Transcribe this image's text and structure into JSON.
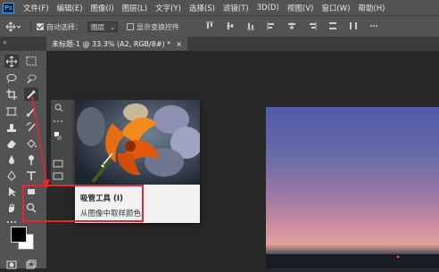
{
  "app": {
    "logo": "Ps"
  },
  "menu": [
    "文件(F)",
    "编辑(E)",
    "图像(I)",
    "图层(L)",
    "文字(Y)",
    "选择(S)",
    "滤镜(T)",
    "3D(D)",
    "视图(V)",
    "窗口(W)",
    "帮助(H)"
  ],
  "options": {
    "auto_select_label": "自动选择：",
    "auto_select_value": "图层",
    "show_transform_label": "显示变换控件"
  },
  "document": {
    "tab_label": "未标题-1 @ 33.3% (A2, RGB/8#) *",
    "close": "×"
  },
  "tooltip": {
    "title": "吸管工具 (I)",
    "description": "从图像中取样颜色"
  },
  "colors": {
    "accent_highlight": "#e8262c",
    "ps_blue": "#31a8ff",
    "foreground": "#000000",
    "background": "#ffffff"
  }
}
